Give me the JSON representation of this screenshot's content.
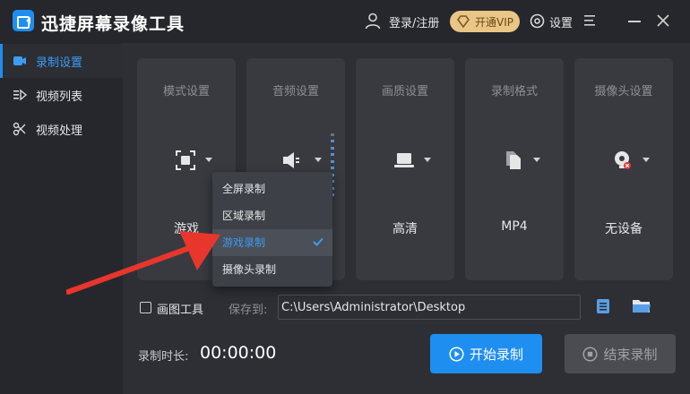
{
  "app": {
    "title": "迅捷屏幕录像工具"
  },
  "header": {
    "login_label": "登录/注册",
    "vip_label": "开通VIP",
    "settings_label": "设置"
  },
  "sidebar": {
    "items": [
      {
        "label": "录制设置",
        "icon": "record-settings-icon",
        "active": true
      },
      {
        "label": "视频列表",
        "icon": "video-list-icon",
        "active": false
      },
      {
        "label": "视频处理",
        "icon": "video-process-icon",
        "active": false
      }
    ]
  },
  "cards": [
    {
      "title": "模式设置",
      "value": "游戏",
      "icon": "mode-icon"
    },
    {
      "title": "音频设置",
      "value": "",
      "icon": "speaker-icon"
    },
    {
      "title": "画质设置",
      "value": "高清",
      "icon": "laptop-icon"
    },
    {
      "title": "录制格式",
      "value": "MP4",
      "icon": "file-icon"
    },
    {
      "title": "摄像头设置",
      "value": "无设备",
      "icon": "camera-icon"
    }
  ],
  "mode_dropdown": {
    "options": [
      "全屏录制",
      "区域录制",
      "游戏录制",
      "摄像头录制"
    ],
    "selected": "游戏录制"
  },
  "bottom": {
    "draw_tool_label": "画图工具",
    "save_to_label": "保存到:",
    "save_path": "C:\\Users\\Administrator\\Desktop",
    "duration_label": "录制时长:",
    "duration_value": "00:00:00",
    "start_label": "开始录制",
    "stop_label": "结束录制"
  },
  "colors": {
    "accent": "#1f8ef1",
    "vip": "#e9c586",
    "annotation_arrow": "#e8362c"
  }
}
